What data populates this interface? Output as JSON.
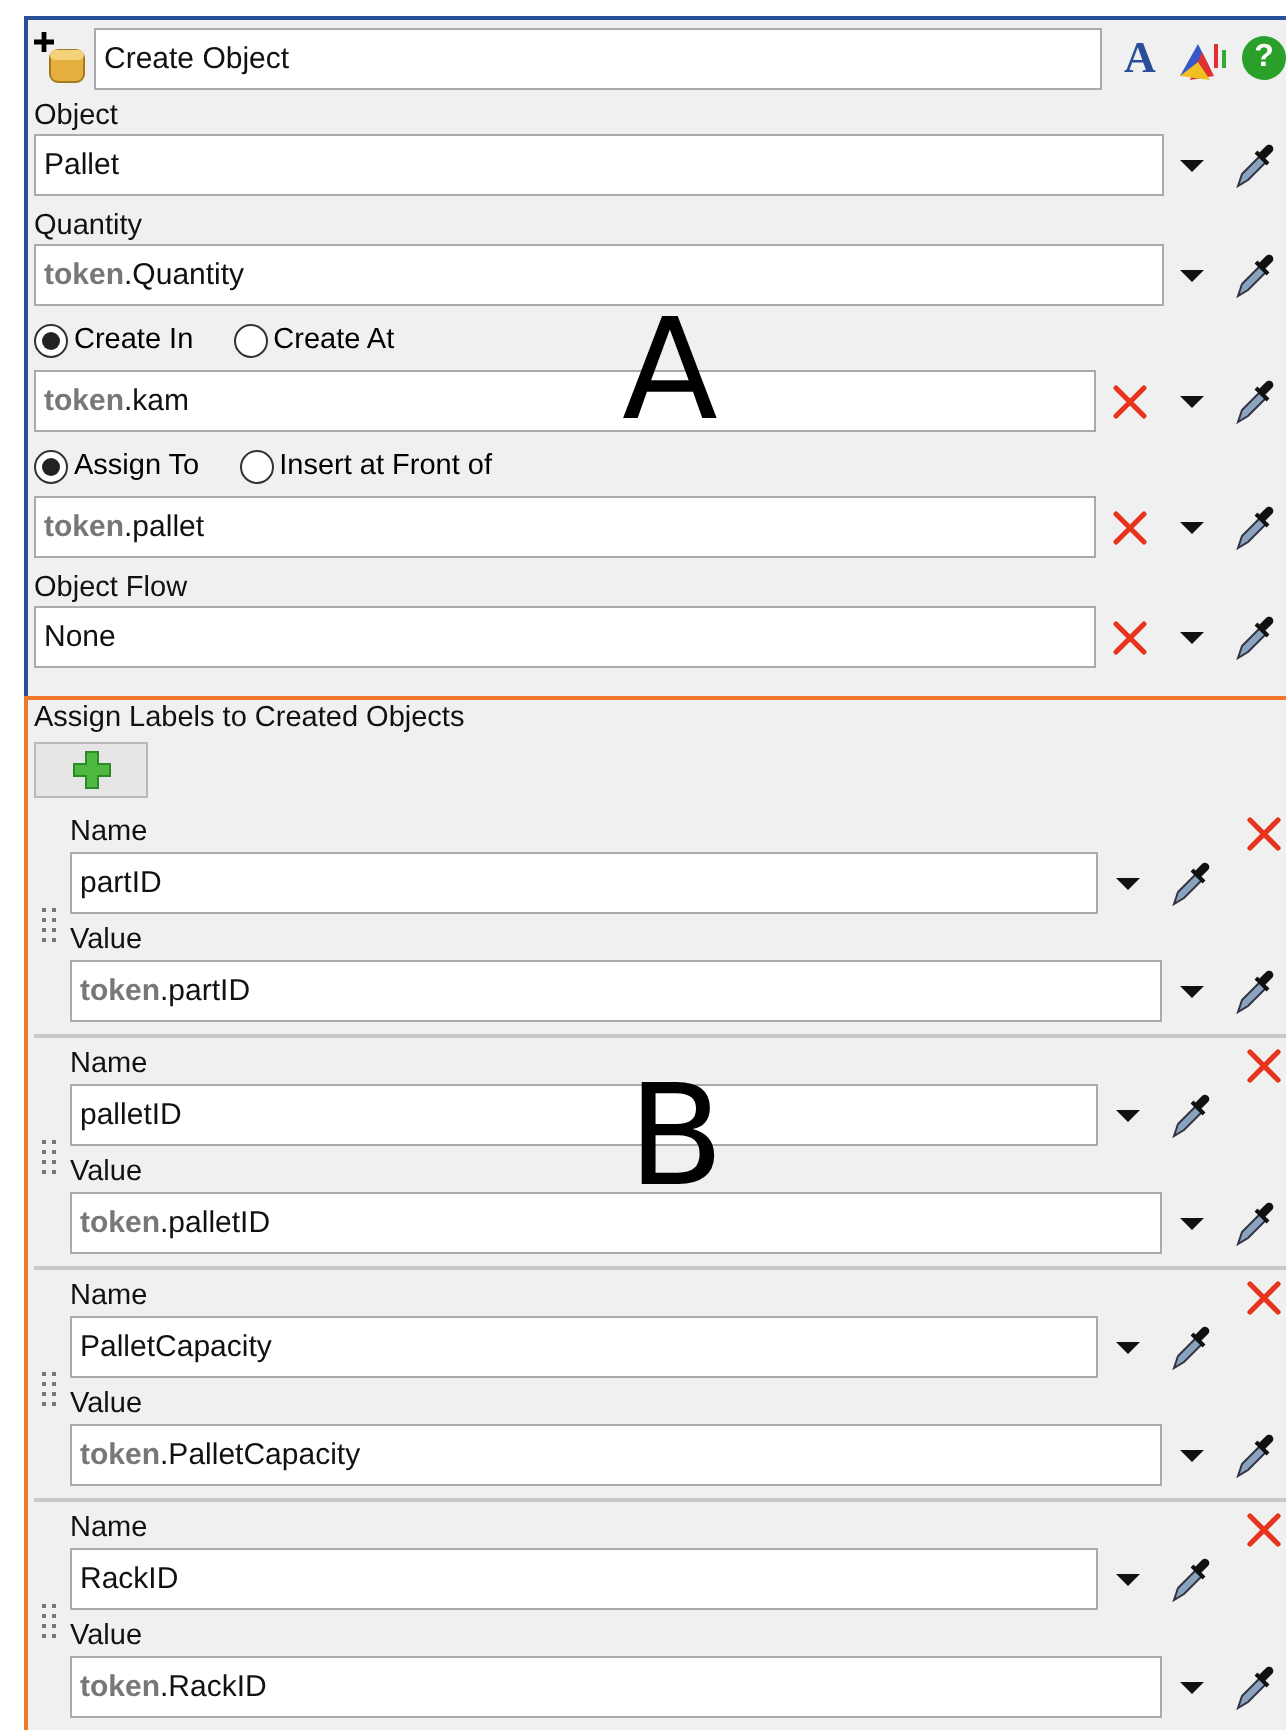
{
  "header": {
    "title": "Create Object",
    "tools": [
      {
        "kind": "font",
        "text": "A"
      },
      {
        "kind": "chart"
      },
      {
        "kind": "help",
        "text": "?"
      }
    ]
  },
  "fields": [
    {
      "kind": "plain",
      "label": "Object",
      "value": "Pallet",
      "clearable": false
    },
    {
      "kind": "plain",
      "label": "Quantity",
      "value": "**token**.Quantity",
      "clearable": false
    },
    {
      "kind": "radio",
      "options": [
        {
          "label": "Create In",
          "selected": true
        },
        {
          "label": "Create At",
          "selected": false
        }
      ],
      "value": "**token**.kam",
      "clearable": true
    },
    {
      "kind": "radio",
      "options": [
        {
          "label": "Assign To",
          "selected": true
        },
        {
          "label": "Insert at Front of",
          "selected": false
        }
      ],
      "value": "**token**.pallet",
      "clearable": true
    },
    {
      "kind": "plain",
      "label": "Object Flow",
      "value": "None",
      "clearable": true
    }
  ],
  "section_a_mark": "A",
  "labels": {
    "title": "Assign Labels to Created Objects",
    "entries": [
      {
        "name_label": "Name",
        "name": "partID",
        "value_label": "Value",
        "value": "**token**.partID"
      },
      {
        "name_label": "Name",
        "name": "palletID",
        "value_label": "Value",
        "value": "**token**.palletID"
      },
      {
        "name_label": "Name",
        "name": "PalletCapacity",
        "value_label": "Value",
        "value": "**token**.PalletCapacity"
      },
      {
        "name_label": "Name",
        "name": "RackID",
        "value_label": "Value",
        "value": "**token**.RackID"
      }
    ]
  },
  "section_b_mark": "B"
}
